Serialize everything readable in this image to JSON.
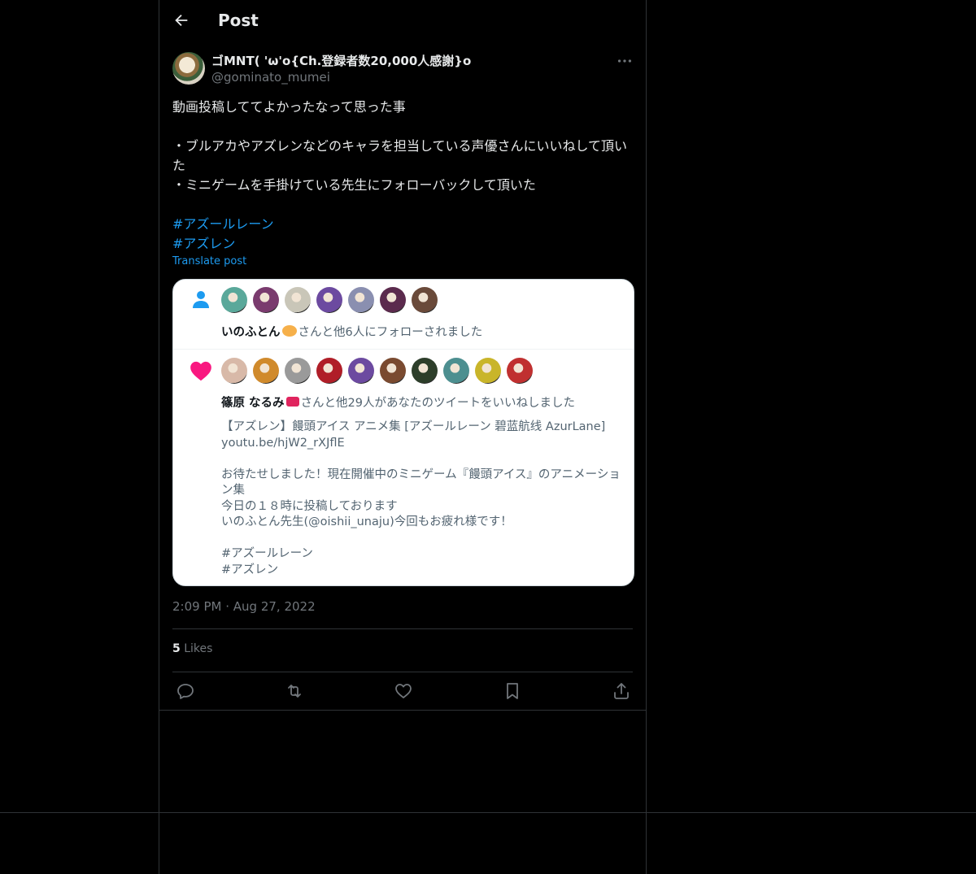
{
  "header": {
    "title": "Post"
  },
  "post": {
    "display_name": "ゴMNT( 'ω'o{Ch.登録者数20,000人感謝}o",
    "handle": "@gominato_mumei",
    "body_lines": [
      "動画投稿しててよかったなって思った事",
      "",
      "・ブルアカやアズレンなどのキャラを担当している声優さんにいいねして頂いた",
      "・ミニゲームを手掛けている先生にフォローバックして頂いた",
      ""
    ],
    "hashtags": [
      "#アズールレーン",
      "#アズレン"
    ],
    "translate_label": "Translate post",
    "time": "2:09 PM",
    "date": "Aug 27, 2022",
    "likes_count": "5",
    "likes_label": "Likes"
  },
  "card": {
    "follow_name": "いのふとん",
    "follow_text": "さんと他6人にフォローされました",
    "like_name": "篠原 なるみ",
    "like_text": "さんと他29人があなたのツイートをいいねしました",
    "quoted_lines": [
      "【アズレン】饅頭アイス アニメ集 [アズールレーン 碧蓝航线 AzurLane]",
      "youtu.be/hjW2_rXJflE",
      "",
      "お待たせしました！現在開催中のミニゲーム『饅頭アイス』のアニメーション集",
      "今日の１８時に投稿しております",
      "いのふとん先生(@oishii_unaju)今回もお疲れ様です！",
      "",
      "#アズールレーン",
      "#アズレン"
    ],
    "follow_avatar_colors": [
      "#5aa89a",
      "#7a3b6e",
      "#c9c6b8",
      "#6c4aa0",
      "#8a8fb0",
      "#5b2a4d",
      "#6a4a3a"
    ],
    "like_avatar_colors": [
      "#d8b9a8",
      "#d08a2c",
      "#9a9a9a",
      "#b01e28",
      "#6c4aa0",
      "#7a4a30",
      "#2d3e2a",
      "#4d8f90",
      "#c9b52a",
      "#c03030"
    ],
    "accent_person": "#1d9bf0",
    "accent_heart": "#f91880"
  },
  "icons": {
    "back": "arrow-left-icon",
    "more": "more-dots-icon",
    "reply": "reply-icon",
    "repost": "repost-icon",
    "like": "heart-icon",
    "bookmark": "bookmark-icon",
    "share": "share-icon"
  }
}
